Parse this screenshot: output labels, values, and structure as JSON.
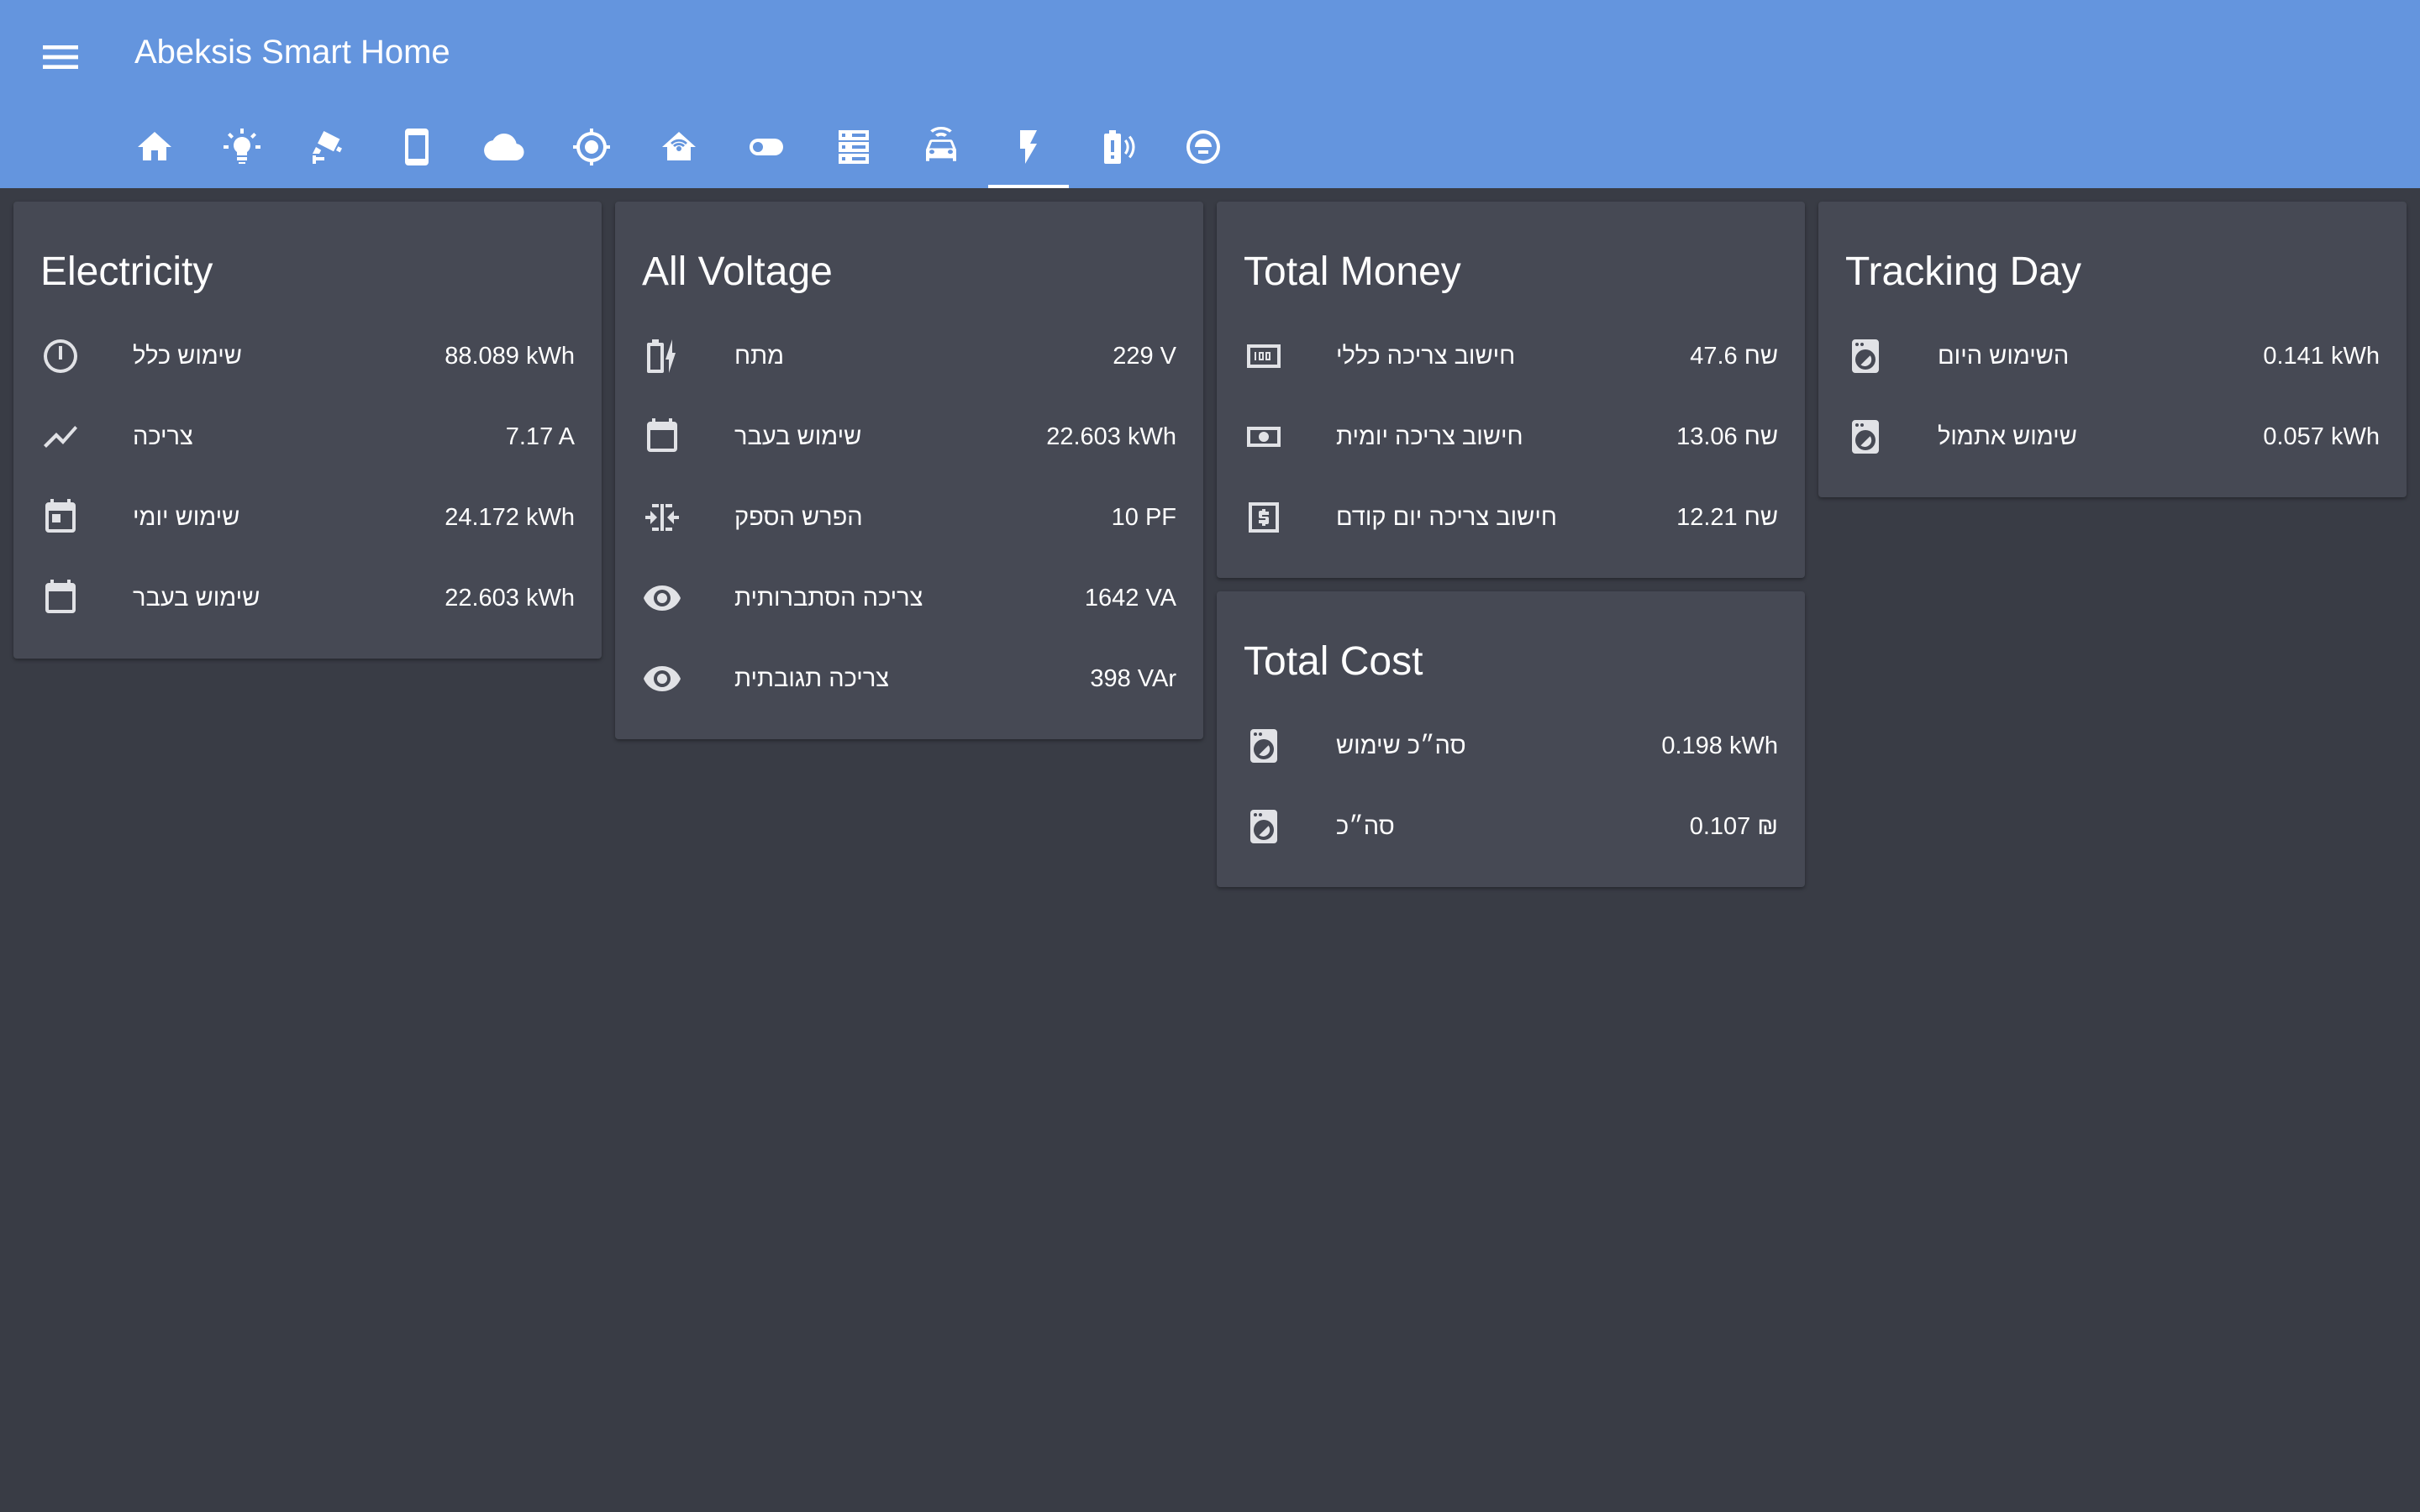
{
  "app": {
    "title": "Abeksis Smart Home"
  },
  "header": {
    "menu_icon": "menu-icon",
    "tabs": [
      {
        "icon": "home-icon",
        "active": false
      },
      {
        "icon": "lightbulb-icon",
        "active": false
      },
      {
        "icon": "cctv-camera-icon",
        "active": false
      },
      {
        "icon": "cellphone-icon",
        "active": false
      },
      {
        "icon": "cloud-icon",
        "active": false
      },
      {
        "icon": "crosshairs-gps-icon",
        "active": false
      },
      {
        "icon": "home-wifi-icon",
        "active": false
      },
      {
        "icon": "toggle-switch-icon",
        "active": false
      },
      {
        "icon": "server-icon",
        "active": false
      },
      {
        "icon": "car-wifi-icon",
        "active": false
      },
      {
        "icon": "flash-icon",
        "active": true
      },
      {
        "icon": "battery-alert-icon",
        "active": false
      },
      {
        "icon": "robot-vacuum-icon",
        "active": false
      }
    ]
  },
  "cards": {
    "electricity": {
      "title": "Electricity",
      "rows": [
        {
          "icon": "power-meter-icon",
          "name": "שימוש כלל",
          "value": "88.089 kWh"
        },
        {
          "icon": "chart-line-icon",
          "name": "צריכה",
          "value": "7.17 A"
        },
        {
          "icon": "calendar-today-icon",
          "name": "שימוש יומי",
          "value": "24.172 kWh"
        },
        {
          "icon": "calendar-icon",
          "name": "שימוש בעבר",
          "value": "22.603 kWh"
        }
      ]
    },
    "voltage": {
      "title": "All Voltage",
      "rows": [
        {
          "icon": "battery-charging-icon",
          "name": "מתח",
          "value": "229 V"
        },
        {
          "icon": "calendar-icon",
          "name": "שימוש בעבר",
          "value": "22.603 kWh"
        },
        {
          "icon": "format-horizontal-align-center-icon",
          "name": "הפרש הספק",
          "value": "10 PF"
        },
        {
          "icon": "eye-icon",
          "name": "צריכה הסתברותית",
          "value": "1642 VA"
        },
        {
          "icon": "eye-icon",
          "name": "צריכה תגובתית",
          "value": "398 VAr"
        }
      ]
    },
    "money": {
      "title": "Total Money",
      "rows": [
        {
          "icon": "cash-100-icon",
          "name": "חישוב צריכה כללי",
          "value": "47.6 שח"
        },
        {
          "icon": "cash-icon",
          "name": "חישוב צריכה יומית",
          "value": "13.06 שח"
        },
        {
          "icon": "currency-usd-box-icon",
          "name": "חישוב צריכה יום קודם",
          "value": "12.21 שח"
        }
      ]
    },
    "tracking": {
      "title": "Tracking Day",
      "rows": [
        {
          "icon": "washing-machine-icon",
          "name": "השימוש היום",
          "value": "0.141 kWh"
        },
        {
          "icon": "washing-machine-icon",
          "name": "שימוש אתמול",
          "value": "0.057 kWh"
        }
      ]
    },
    "cost": {
      "title": "Total Cost",
      "rows": [
        {
          "icon": "washing-machine-icon",
          "name": "סה״כ שימוש",
          "value": "0.198 kWh"
        },
        {
          "icon": "washing-machine-icon",
          "name": "סה״כ",
          "value": "0.107 ₪"
        }
      ]
    }
  },
  "colors": {
    "header": "#6495de",
    "background": "#393c45",
    "card": "#464954",
    "icon": "#e1e2e6"
  }
}
